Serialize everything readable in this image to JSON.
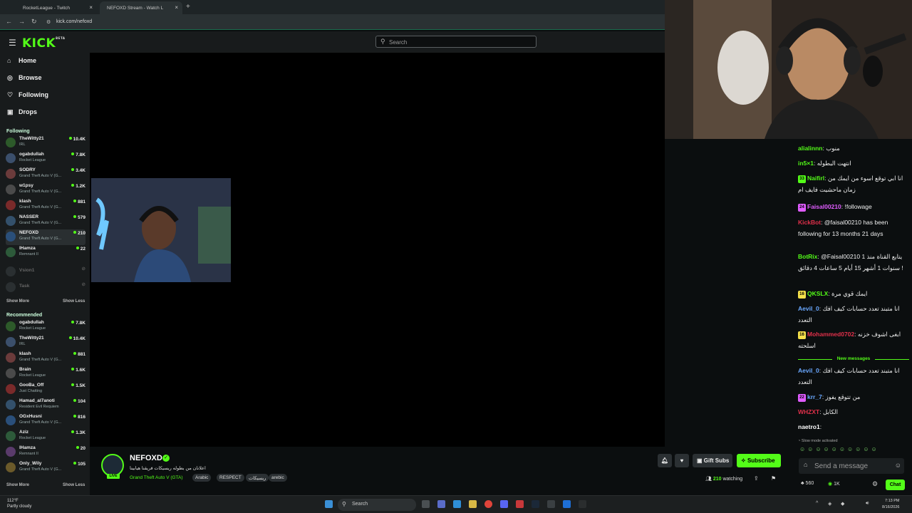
{
  "browser": {
    "tabs": [
      {
        "label": "RocketLeague - Twitch",
        "active": false
      },
      {
        "label": "NEFOXD Stream - Watch L",
        "active": true
      }
    ],
    "url": "kick.com/nefoxd"
  },
  "header": {
    "logo": "KICK",
    "logo_beta": "BETA",
    "search_placeholder": "Search"
  },
  "sidebar": {
    "nav": [
      {
        "label": "Home",
        "icon": "home-icon"
      },
      {
        "label": "Browse",
        "icon": "compass-icon"
      },
      {
        "label": "Following",
        "icon": "heart-icon"
      },
      {
        "label": "Drops",
        "icon": "gift-icon"
      }
    ],
    "following_title": "Following",
    "following": [
      {
        "name": "TheWitty21",
        "game": "IRL",
        "viewers": "10.4K"
      },
      {
        "name": "ogabdullah",
        "game": "Rocket League",
        "viewers": "7.8K"
      },
      {
        "name": "SODRY",
        "game": "Grand Theft Auto V (G...",
        "viewers": "3.4K"
      },
      {
        "name": "w1psy",
        "game": "Grand Theft Auto V (G...",
        "viewers": "1.2K"
      },
      {
        "name": "klash",
        "game": "Grand Theft Auto V (G...",
        "viewers": "881"
      },
      {
        "name": "NASSER",
        "game": "Grand Theft Auto V (G...",
        "viewers": "579"
      },
      {
        "name": "NEFOXD",
        "game": "Grand Theft Auto V (G...",
        "viewers": "210"
      },
      {
        "name": "lHamza",
        "game": "Remnant II",
        "viewers": "22"
      }
    ],
    "offline": [
      {
        "name": "Vsion1"
      },
      {
        "name": "Task"
      }
    ],
    "show_more": "Show More",
    "show_less": "Show Less",
    "recommended_title": "Recommended",
    "recommended": [
      {
        "name": "ogabdullah",
        "game": "Rocket League",
        "viewers": "7.8K"
      },
      {
        "name": "TheWitty21",
        "game": "IRL",
        "viewers": "10.4K"
      },
      {
        "name": "klash",
        "game": "Grand Theft Auto V (G...",
        "viewers": "881"
      },
      {
        "name": "Brain",
        "game": "Rocket League",
        "viewers": "1.6K"
      },
      {
        "name": "GooBa_Off",
        "game": "Just Chatting",
        "viewers": "1.5K"
      },
      {
        "name": "Hamad_al7anoti",
        "game": "Resident Evil Requiem",
        "viewers": "104"
      },
      {
        "name": "OGxHusni",
        "game": "Grand Theft Auto V (G...",
        "viewers": "816"
      },
      {
        "name": "Aziz",
        "game": "Rocket League",
        "viewers": "1.3K"
      },
      {
        "name": "lHamza",
        "game": "Remnant II",
        "viewers": "20"
      },
      {
        "name": "Only_Wily",
        "game": "Grand Theft Auto V (G...",
        "viewers": "105"
      }
    ]
  },
  "stream": {
    "channel": "NEFOXD",
    "title": "اعلانان من بطوله ريسيكات فريقنا هيابينا",
    "game": "Grand Theft Auto V (GTA)",
    "tags": [
      "Arabic",
      "RESPECT",
      "ريسيكات",
      "arebic"
    ],
    "live_label": "LIVE",
    "gift_subs": "Gift Subs",
    "subscribe": "Subscribe",
    "watching_count": "210",
    "watching_label": "watching"
  },
  "chat": {
    "messages": [
      {
        "user": "alialinnn",
        "color": "#53fc18",
        "badge": "",
        "text": "منوب"
      },
      {
        "user": "in5×1",
        "color": "#53fc18",
        "badge": "",
        "text": "انتهت البطوله"
      },
      {
        "user": "Naifirl",
        "color": "#53fc18",
        "badge": "33",
        "text": "انا ابي توقع اسوء من ايمك من زمان ماحشيت فايف ام"
      },
      {
        "user": "Faisal00210",
        "color": "#e05cff",
        "badge": "24",
        "text": "!followage"
      },
      {
        "user": "KickBot",
        "color": "#e0304a",
        "badge": "",
        "text": "@faisal00210 has been following for 13 months 21 days"
      },
      {
        "user": "BotRix",
        "color": "#53fc18",
        "badge": "",
        "text": "@Faisal00210 يتابع القناة منذ 1 سنوات 1 أشهر 15 أيام 5 ساعات 4 دقائق !"
      },
      {
        "user": "QKSLX",
        "color": "#53fc18",
        "badge": "16",
        "text": "ايمك قوي مرة"
      },
      {
        "user": "Aevil_0",
        "color": "#6aa8ff",
        "badge": "",
        "text": "انا متبند تعدد حسابات كيف افك التعدد"
      },
      {
        "user": "Mohammed0702",
        "color": "#e0304a",
        "badge": "16",
        "text": "ابغى اشوف خزنه اسلحته"
      }
    ],
    "new_messages": "New messages",
    "new": [
      {
        "user": "Aevil_0",
        "color": "#6aa8ff",
        "badge": "",
        "text": "انا متبند تعدد حسابات كيف افك التعدد"
      },
      {
        "user": "krr_7",
        "color": "#6aa8ff",
        "badge": "22",
        "text": "من تتوقع يفوز"
      },
      {
        "user": "WHZXT",
        "color": "#e0304a",
        "badge": "",
        "text": "الكابل"
      },
      {
        "user": "naetro1",
        "color": "#ffffff",
        "badge": "",
        "text": ""
      }
    ],
    "slow_mode": "Slow mode activated",
    "input_placeholder": "Send a message",
    "points": "560",
    "currency": "1K",
    "chat_button": "Chat"
  },
  "taskbar": {
    "weather_temp": "112°F",
    "weather_desc": "Partly cloudy",
    "search": "Search",
    "time": "7:13 PM",
    "date": "8/16/2026"
  }
}
